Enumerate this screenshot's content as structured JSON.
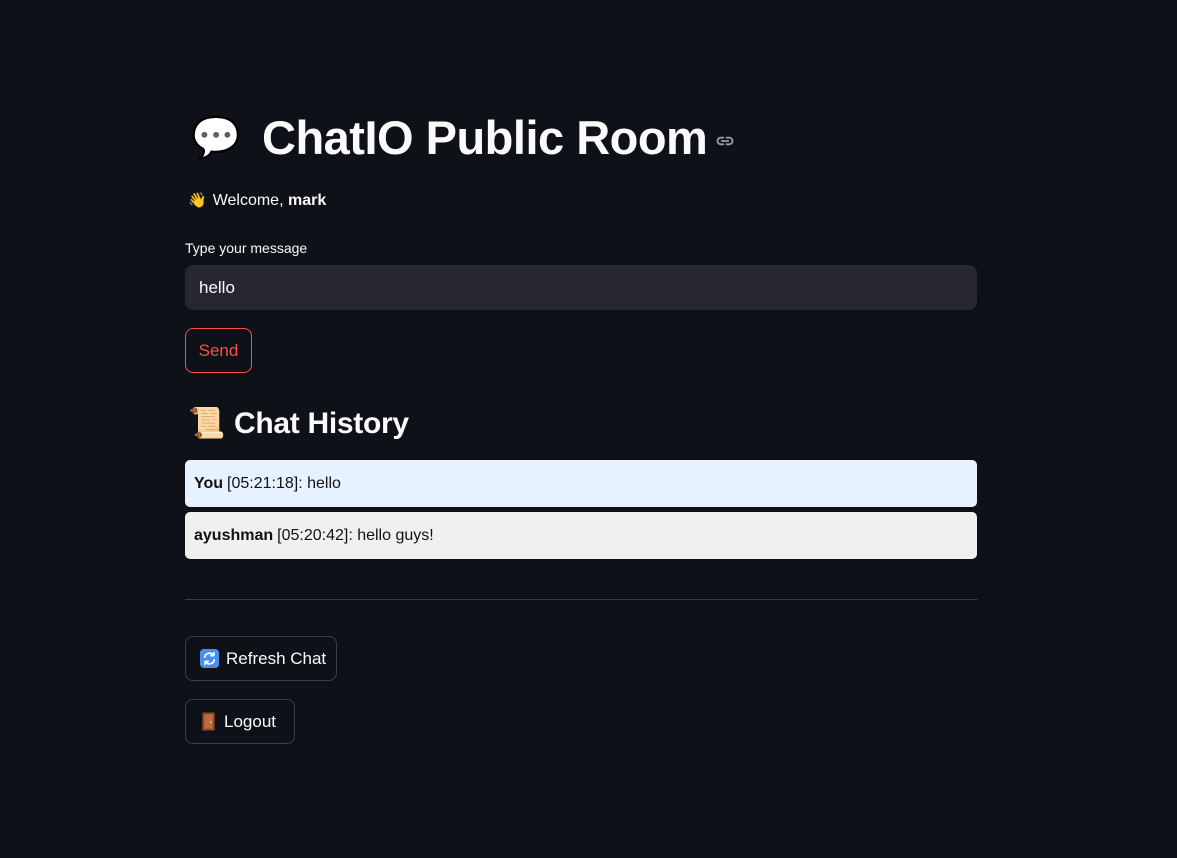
{
  "header": {
    "emoji": "💬",
    "title": "ChatIO Public Room",
    "link_icon": "link-icon"
  },
  "welcome": {
    "emoji": "👋",
    "prefix": "Welcome, ",
    "username": "mark"
  },
  "message_input": {
    "label": "Type your message",
    "value": "hello"
  },
  "send_button": {
    "label": "Send"
  },
  "history": {
    "emoji": "📜",
    "title": "Chat History",
    "messages": [
      {
        "sender": "You",
        "meta": "[05:21:18]: hello"
      },
      {
        "sender": "ayushman",
        "meta": "[05:20:42]: hello guys!"
      }
    ]
  },
  "actions": {
    "refresh": {
      "icon": "refresh-icon",
      "label": "Refresh Chat"
    },
    "logout": {
      "icon": "door-icon",
      "label": "Logout"
    }
  },
  "colors": {
    "background": "#0e1117",
    "accent": "#ff4b4b",
    "input_bg": "#262730",
    "own_message_bg": "#e6f2ff",
    "other_message_bg": "#f0f0f0"
  }
}
